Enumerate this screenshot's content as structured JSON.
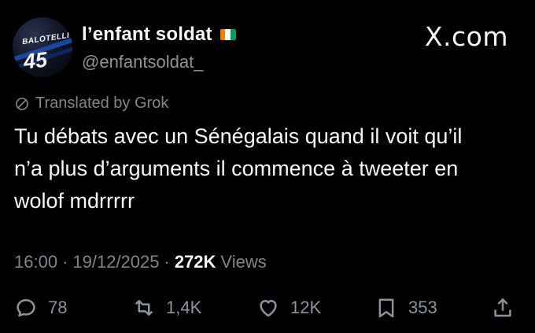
{
  "author": {
    "display_name": "l’enfant soldat",
    "handle": "@enfantsoldat_",
    "avatar": {
      "jersey_name": "BALOTELLI",
      "jersey_number": "45"
    },
    "flag_colors": [
      "#f77f00",
      "#ffffff",
      "#009e60"
    ]
  },
  "brand": {
    "label": "X.com"
  },
  "translation": {
    "icon": "grok-icon",
    "label": "Translated by Grok"
  },
  "tweet": {
    "text": "Tu débats avec un Sénégalais quand il voit qu’il\nn’a plus d’arguments il commence à tweeter en\nwolof mdrrrrr"
  },
  "meta": {
    "time": "16:00",
    "date": "19/12/2025",
    "views_count": "272K",
    "views_label": "Views",
    "separator": "·"
  },
  "actions": {
    "replies": {
      "icon": "reply-icon",
      "count": "78"
    },
    "reposts": {
      "icon": "repost-icon",
      "count": "1,4K"
    },
    "likes": {
      "icon": "like-icon",
      "count": "12K"
    },
    "bookmarks": {
      "icon": "bookmark-icon",
      "count": "353"
    },
    "share": {
      "icon": "share-icon"
    }
  }
}
